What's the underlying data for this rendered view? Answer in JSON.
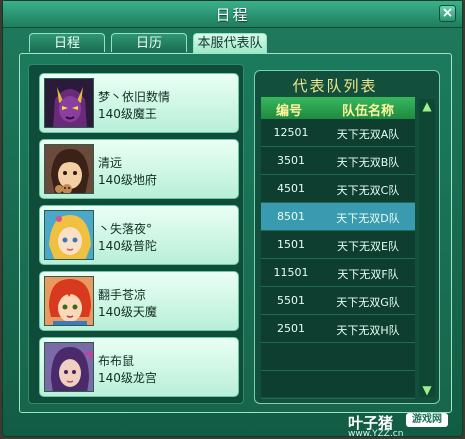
{
  "window": {
    "title": "日程",
    "close_label": "×"
  },
  "tabs": [
    {
      "label": "日程",
      "active": false
    },
    {
      "label": "日历",
      "active": false
    },
    {
      "label": "本服代表队",
      "active": true
    }
  ],
  "members": [
    {
      "name": "梦丶依旧数情",
      "level": "140级魔王"
    },
    {
      "name": "清远",
      "level": "140级地府"
    },
    {
      "name": "丶失落夜°",
      "level": "140级普陀"
    },
    {
      "name": "翻手苍凉",
      "level": "140级天魔"
    },
    {
      "name": "布布鼠",
      "level": "140级龙宫"
    }
  ],
  "team_list": {
    "title": "代表队列表",
    "headers": {
      "id": "编号",
      "name": "队伍名称"
    },
    "rows": [
      {
        "id": "12501",
        "name": "天下无双A队"
      },
      {
        "id": "3501",
        "name": "天下无双B队"
      },
      {
        "id": "4501",
        "name": "天下无双C队"
      },
      {
        "id": "8501",
        "name": "天下无双D队"
      },
      {
        "id": "1501",
        "name": "天下无双E队"
      },
      {
        "id": "11501",
        "name": "天下无双F队"
      },
      {
        "id": "5501",
        "name": "天下无双G队"
      },
      {
        "id": "2501",
        "name": "天下无双H队"
      }
    ],
    "selected_index": 3
  },
  "scroll": {
    "up_icon": "▲",
    "down_icon": "▼"
  },
  "watermark": {
    "main": "叶子猪",
    "badge": "游戏网",
    "url": "www.YZZ.cn"
  },
  "colors": {
    "accent": "#1e7d5d",
    "selected_row": "#3a9ab0",
    "title_gold": "#f1e48a"
  }
}
